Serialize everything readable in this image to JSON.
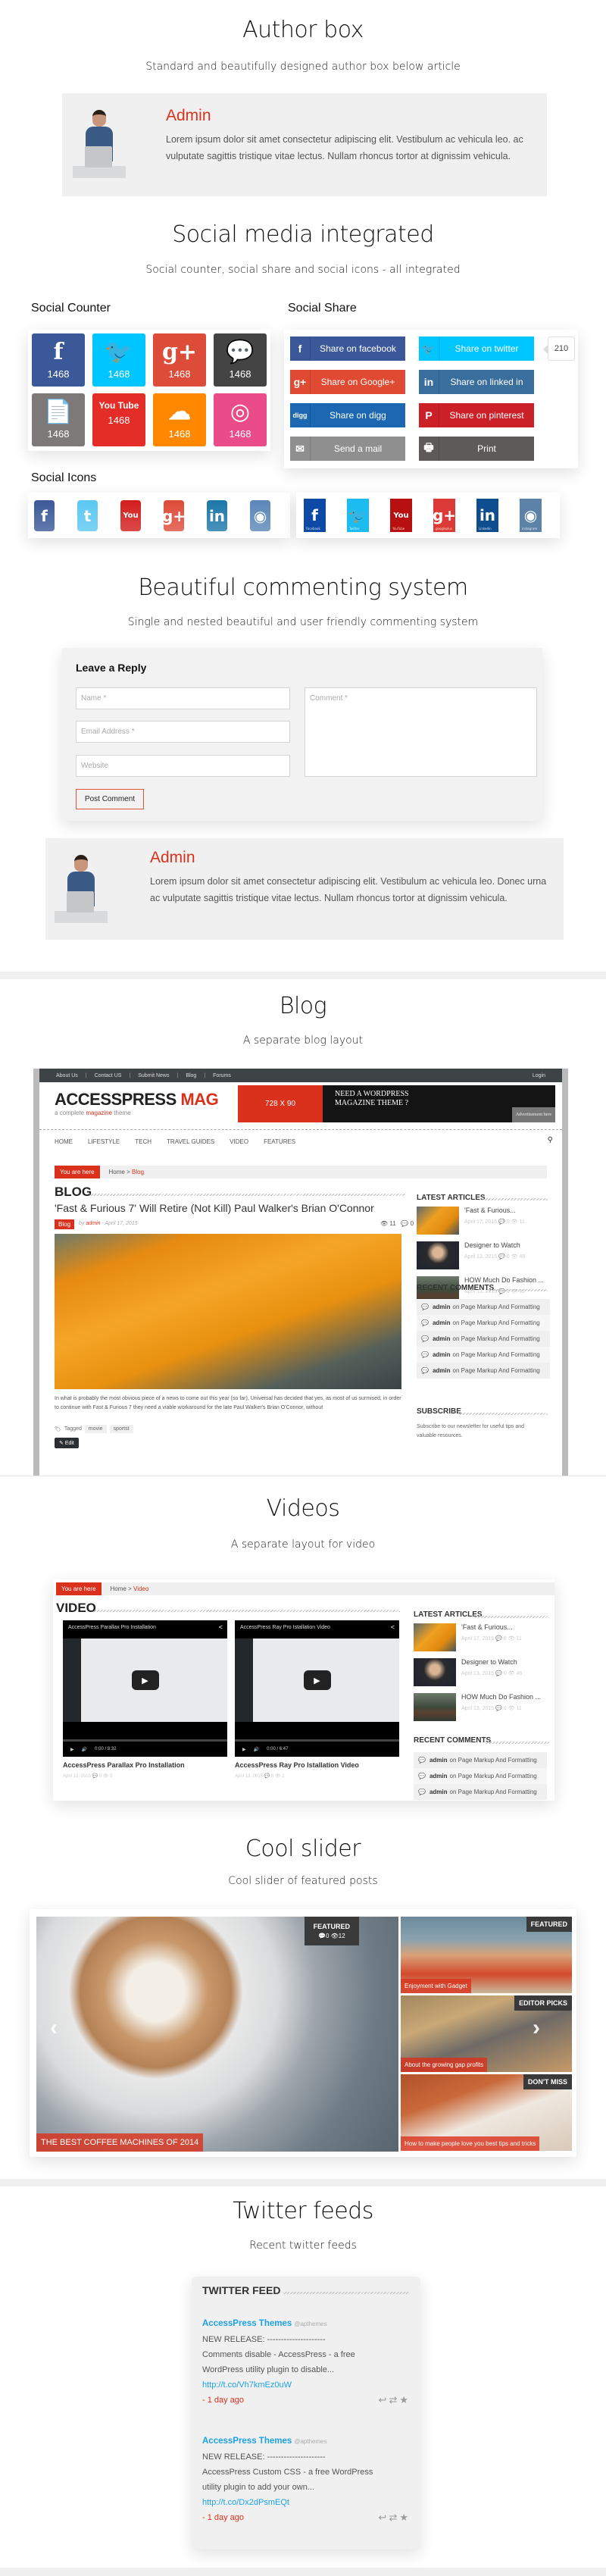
{
  "author_section": {
    "title": "Author box",
    "subtitle": "Standard and beautifully designed author box below article",
    "author": {
      "name": "Admin",
      "bio": "Lorem ipsum dolor sit amet consectetur adipiscing elit. Vestibulum ac vehicula leo. ac vulputate sagittis tristique vitae lectus. Nullam rhoncus tortor at dignissim vehicula."
    }
  },
  "social_section": {
    "title": "Social media integrated",
    "subtitle": "Social counter, social share and social icons - all integrated",
    "counter": {
      "heading": "Social Counter",
      "tiles": [
        {
          "name": "facebook",
          "icon": "f",
          "count": "1468",
          "color": "#3b5998"
        },
        {
          "name": "twitter",
          "icon": "🐦",
          "count": "1468",
          "color": "#00c6ff"
        },
        {
          "name": "googleplus",
          "icon": "g+",
          "count": "1468",
          "color": "#dd4b39"
        },
        {
          "name": "comments",
          "icon": "💬",
          "count": "1468",
          "color": "#444444"
        },
        {
          "name": "posts",
          "icon": "📄",
          "count": "1468",
          "color": "#7d7979"
        },
        {
          "name": "youtube",
          "icon": "You Tube",
          "count": "1468",
          "color": "#e52d27"
        },
        {
          "name": "soundcloud",
          "icon": "☁",
          "count": "1468",
          "color": "#ff8800"
        },
        {
          "name": "dribbble",
          "icon": "◎",
          "count": "1468",
          "color": "#ea4c89"
        }
      ]
    },
    "share": {
      "heading": "Social Share",
      "buttons": [
        {
          "name": "facebook",
          "icon": "f",
          "label": "Share on facebook",
          "color": "#3b5998"
        },
        {
          "name": "twitter",
          "icon": "🐦",
          "label": "Share on twitter",
          "color": "#00c6ff"
        },
        {
          "name": "googleplus",
          "icon": "g+",
          "label": "Share on Google+",
          "color": "#e04a33"
        },
        {
          "name": "linkedin",
          "icon": "in",
          "label": "Share on linked in",
          "color": "#3a6f9d"
        },
        {
          "name": "digg",
          "icon": "digg",
          "label": "Share on digg",
          "color": "#1b67b1"
        },
        {
          "name": "pinterest",
          "icon": "P",
          "label": "Share on pinterest",
          "color": "#cb2027"
        },
        {
          "name": "mail",
          "icon": "✉",
          "label": "Send a mail",
          "color": "#8f8f8f"
        },
        {
          "name": "print",
          "icon": "🖶",
          "label": "Print",
          "color": "#5e5a59"
        }
      ],
      "twitter_count": "210"
    },
    "icons": {
      "heading": "Social Icons",
      "set1": [
        {
          "name": "facebook",
          "glyph": "f",
          "color": "#3b5998"
        },
        {
          "name": "twitter",
          "glyph": "t",
          "color": "#5bc8f2"
        },
        {
          "name": "youtube",
          "glyph": "You",
          "color": "#d21c1c"
        },
        {
          "name": "googleplus",
          "glyph": "g+",
          "color": "#de4b39"
        },
        {
          "name": "linkedin",
          "glyph": "in",
          "color": "#1a77a8"
        },
        {
          "name": "instagram",
          "glyph": "◉",
          "color": "#5a86b8"
        }
      ],
      "set2": [
        {
          "name": "facebook",
          "glyph": "f",
          "caption": "Facebook",
          "color": "#0d4aa6"
        },
        {
          "name": "twitter",
          "glyph": "🐦",
          "caption": "Twitter",
          "color": "#1cbcf0"
        },
        {
          "name": "youtube",
          "glyph": "You",
          "caption": "YouTube",
          "color": "#b81010"
        },
        {
          "name": "googleplus",
          "glyph": "g+",
          "caption": "googleplus",
          "color": "#dc3a36"
        },
        {
          "name": "linkedin",
          "glyph": "in",
          "caption": "Linkedin",
          "color": "#0f4e8e"
        },
        {
          "name": "instagram",
          "glyph": "◉",
          "caption": "instagram",
          "color": "#5d82a8"
        }
      ]
    }
  },
  "comment_section": {
    "title": "Beautiful commenting system",
    "subtitle": "Single and nested beautiful and user friendly commenting system",
    "form": {
      "heading": "Leave a Reply",
      "name_placeholder": "Name *",
      "email_placeholder": "Email Address *",
      "website_placeholder": "Website",
      "comment_placeholder": "Comment *",
      "submit_label": "Post Comment"
    },
    "author": {
      "name": "Admin",
      "bio": "Lorem ipsum dolor sit amet consectetur adipiscing elit. Vestibulum ac vehicula leo. Donec urna ac vulputate sagittis tristique vitae lectus. Nullam rhoncus tortor at dignissim vehicula."
    }
  },
  "blog_section": {
    "title": "Blog",
    "subtitle": "A separate blog layout",
    "topbar": {
      "links": [
        "About Us",
        "Contact US",
        "Submit News",
        "Blog",
        "Forums"
      ],
      "login": "Login"
    },
    "logo": {
      "main": "ACCESSPRESS",
      "accent": "MAG",
      "tagline_pre": "a complete",
      "tagline_hl": "magazine",
      "tagline_post": "theme"
    },
    "ad": {
      "size": "728 X 90",
      "text": "NEED A WORDPRESS MAGAZINE THEME ?",
      "note": "Advertisement here"
    },
    "nav": [
      "HOME",
      "LIFESTYLE",
      "TECH",
      "TRAVEL GUIDES",
      "VIDEO",
      "FEATURES"
    ],
    "breadcrumb": {
      "here": "You are here",
      "home": "Home",
      "sep": ">",
      "current": "Blog"
    },
    "page_heading": "BLOG",
    "post": {
      "title": "'Fast & Furious 7' Will Retire (Not Kill) Paul Walker's Brian O'Connor",
      "category": "Blog",
      "by": "by",
      "author": "admin",
      "date": "- April 17, 2015",
      "views": "11",
      "comments": "0",
      "excerpt": "In what is probably the most obvious piece of a news to come out this year (so far), Universal has decided that yes, as most of us surmised, in order to continue with Fast & Furious 7 they need a viable workaround for the late Paul Walker's Brian O'Connor, without",
      "tagged_label": "Tagged",
      "tags": [
        "movie",
        "sportst"
      ],
      "edit_label": "Edit"
    },
    "sidebar": {
      "latest_heading": "LATEST ARTICLES",
      "latest": [
        {
          "title": "'Fast & Furious...",
          "date": "April 17, 2015",
          "comments": "0",
          "views": "11"
        },
        {
          "title": "Designer to Watch",
          "date": "April 13, 2015",
          "comments": "0",
          "views": "46"
        },
        {
          "title": "HOW Much Do Fashion ...",
          "date": "April 13, 2015",
          "comments": "0",
          "views": "11"
        }
      ],
      "comments_heading": "RECENT COMMENTS",
      "comments": [
        {
          "who": "admin",
          "on": "on",
          "post": "Page Markup And Formatting"
        },
        {
          "who": "admin",
          "on": "on",
          "post": "Page Markup And Formatting"
        },
        {
          "who": "admin",
          "on": "on",
          "post": "Page Markup And Formatting"
        },
        {
          "who": "admin",
          "on": "on",
          "post": "Page Markup And Formatting"
        },
        {
          "who": "admin",
          "on": "on",
          "post": "Page Markup And Formatting"
        }
      ],
      "subscribe_heading": "SUBSCRIBE",
      "subscribe_text": "Subscribe to our newsletter for useful tips and valuable resources."
    }
  },
  "video_section": {
    "title": "Videos",
    "subtitle": "A separate layout for video",
    "breadcrumb": {
      "here": "You are here",
      "home": "Home",
      "sep": ">",
      "current": "Video"
    },
    "page_heading": "VIDEO",
    "videos": [
      {
        "title": "AccessPress Parallax Pro Installation",
        "time": "0:00 / 8:32",
        "caption": "AccessPress Parallax Pro Installation",
        "date": "April 13, 2015",
        "comments": "0",
        "views": "5"
      },
      {
        "title": "AccessPress Ray Pro Istallation Video",
        "time": "0:00 / 6:47",
        "caption": "AccessPress Ray Pro Istallation Video",
        "date": "April 13, 2015",
        "comments": "0",
        "views": "2"
      }
    ],
    "sidebar": {
      "latest_heading": "LATEST ARTICLES",
      "latest": [
        {
          "title": "'Fast & Furious...",
          "date": "April 17, 2015",
          "comments": "0",
          "views": "11"
        },
        {
          "title": "Designer to Watch",
          "date": "April 13, 2015",
          "comments": "0",
          "views": "46"
        },
        {
          "title": "HOW Much Do Fashion ...",
          "date": "April 13, 2015",
          "comments": "0",
          "views": "11"
        }
      ],
      "comments_heading": "RECENT COMMENTS",
      "comments": [
        {
          "who": "admin",
          "on": "on",
          "post": "Page Markup And Formatting"
        },
        {
          "who": "admin",
          "on": "on",
          "post": "Page Markup And Formatting"
        },
        {
          "who": "admin",
          "on": "on",
          "post": "Page Markup And Formatting"
        }
      ]
    }
  },
  "slider_section": {
    "title": "Cool slider",
    "subtitle": "Cool slider of featured posts",
    "main": {
      "label": "FEATURED",
      "comments": "0",
      "views": "12",
      "caption": "THE BEST COFFEE MACHINES OF 2014"
    },
    "side": [
      {
        "label": "FEATURED",
        "caption": "Enjoyment with Gadget"
      },
      {
        "label": "EDITOR PICKS",
        "caption": "About the growing gap profits"
      },
      {
        "label": "DON'T MISS",
        "caption": "How to make people love you best tips and tricks"
      }
    ]
  },
  "twitter_section": {
    "title": "Twitter feeds",
    "subtitle": "Recent twitter feeds",
    "widget_heading": "TWITTER FEED",
    "tweets": [
      {
        "account": "AccessPress Themes",
        "handle": "@apthemes",
        "lines": [
          "NEW RELEASE: ---------------------",
          "Comments disable - AccessPress - a free",
          "WordPress utility plugin to disable..."
        ],
        "link": "http://t.co/Vh7kmEz0uW",
        "ago": "- 1 day ago"
      },
      {
        "account": "AccessPress Themes",
        "handle": "@apthemes",
        "lines": [
          "NEW RELEASE: ---------------------",
          "AccessPress Custom CSS - a free WordPress",
          "utility plugin to add your own..."
        ],
        "link": "http://t.co/Dx2dPsmEQt",
        "ago": "- 1 day ago"
      }
    ]
  }
}
